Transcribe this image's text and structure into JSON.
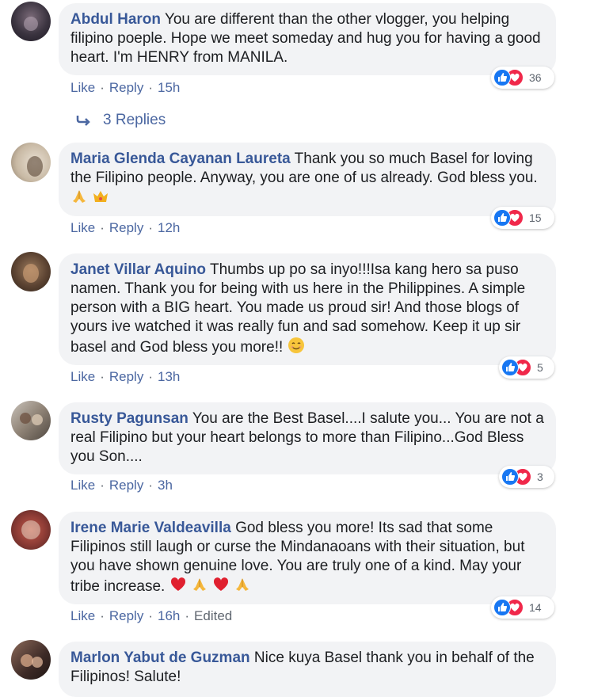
{
  "actions": {
    "like": "Like",
    "reply": "Reply",
    "sep": "·",
    "edited": "Edited"
  },
  "replies_link": {
    "label": "3 Replies",
    "icon": "reply-arrow-icon"
  },
  "colors": {
    "author": "#385898",
    "bubble": "#f2f3f5",
    "like_reaction": "#1877f2",
    "love_reaction": "#f0284a"
  },
  "comments": [
    {
      "author": "Abdul Haron",
      "text": "You are different than the other vlogger, you helping filipino poeple. Hope we meet someday and hug you for having a good heart. I'm HENRY from MANILA.",
      "time": "15h",
      "reactions": "36"
    },
    {
      "author": "Maria Glenda Cayanan Laureta",
      "text": "Thank you so much Basel for loving the Filipino people. Anyway, you are one of us already. God bless you.",
      "emojis": [
        "folded-hands-emoji",
        "crown-emoji"
      ],
      "time": "12h",
      "reactions": "15"
    },
    {
      "author": "Janet Villar Aquino",
      "text": "Thumbs up po sa inyo!!!Isa kang hero sa puso namen. Thank you for being with us here in the Philippines. A simple person with a BIG heart. You made us proud sir! And those blogs of yours ive watched it was really fun and sad somehow. Keep it up sir basel and God bless you more!!",
      "emojis": [
        "smiling-face-emoji"
      ],
      "time": "13h",
      "reactions": "5"
    },
    {
      "author": "Rusty Pagunsan",
      "text": "You are the Best Basel....I salute you... You are not a real Filipino but your heart belongs to more than Filipino...God Bless you Son....",
      "time": "3h",
      "reactions": "3"
    },
    {
      "author": "Irene Marie Valdeavilla",
      "text": "God bless you more! Its sad that some Filipinos still laugh or curse the Mindanaoans with their situation, but you have shown genuine love. You are truly one of a kind. May your tribe increase.",
      "emojis": [
        "red-heart-emoji",
        "folded-hands-emoji",
        "red-heart-emoji",
        "folded-hands-emoji"
      ],
      "time": "16h",
      "edited": true,
      "reactions": "14"
    },
    {
      "author": "Marlon Yabut de Guzman",
      "text": "Nice kuya Basel thank you in behalf of the Filipinos! Salute!"
    }
  ]
}
